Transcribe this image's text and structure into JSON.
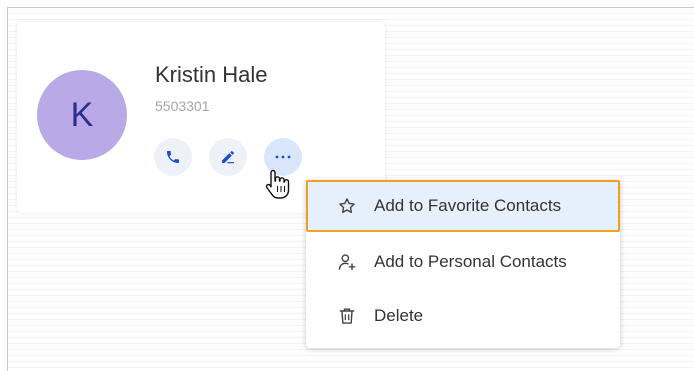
{
  "contact": {
    "avatar_initial": "K",
    "name": "Kristin Hale",
    "number": "5503301"
  },
  "actions": [
    {
      "icon": "phone-icon"
    },
    {
      "icon": "edit-icon"
    },
    {
      "icon": "more-icon"
    }
  ],
  "menu": {
    "items": [
      {
        "label": "Add to Favorite Contacts",
        "icon": "star-icon",
        "highlighted": true
      },
      {
        "label": "Add to Personal Contacts",
        "icon": "add-person-icon",
        "highlighted": false
      },
      {
        "label": "Delete",
        "icon": "trash-icon",
        "highlighted": false
      }
    ]
  },
  "colors": {
    "avatar_bg": "#b9a9e6",
    "avatar_text": "#2c2f8c",
    "icon_blue": "#1a4fd0",
    "highlight_bg": "#e6f0fc",
    "highlight_border": "#f0a020"
  }
}
